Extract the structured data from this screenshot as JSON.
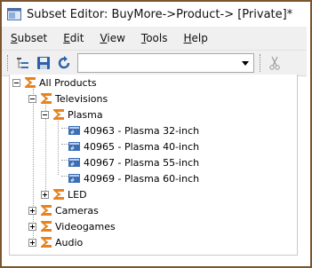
{
  "window": {
    "title": "Subset Editor:  BuyMore->Product->  [Private]*"
  },
  "menu": [
    {
      "mnemonic": "S",
      "rest": "ubset"
    },
    {
      "mnemonic": "E",
      "rest": "dit"
    },
    {
      "mnemonic": "V",
      "rest": "iew"
    },
    {
      "mnemonic": "T",
      "rest": "ools"
    },
    {
      "mnemonic": "H",
      "rest": "elp"
    }
  ],
  "toolbar": {
    "combo_value": ""
  },
  "tree": {
    "root": "All Products",
    "televisions": "Televisions",
    "plasma": "Plasma",
    "plasma_items": [
      "40963 - Plasma 32-inch",
      "40965 - Plasma 40-inch",
      "40967 - Plasma 55-inch",
      "40969 - Plasma 60-inch"
    ],
    "led": "LED",
    "cameras": "Cameras",
    "videogames": "Videogames",
    "audio": "Audio"
  },
  "colors": {
    "sigma": "#e8821e",
    "leaf": "#3a6fb8",
    "frame": "#7a5530"
  }
}
